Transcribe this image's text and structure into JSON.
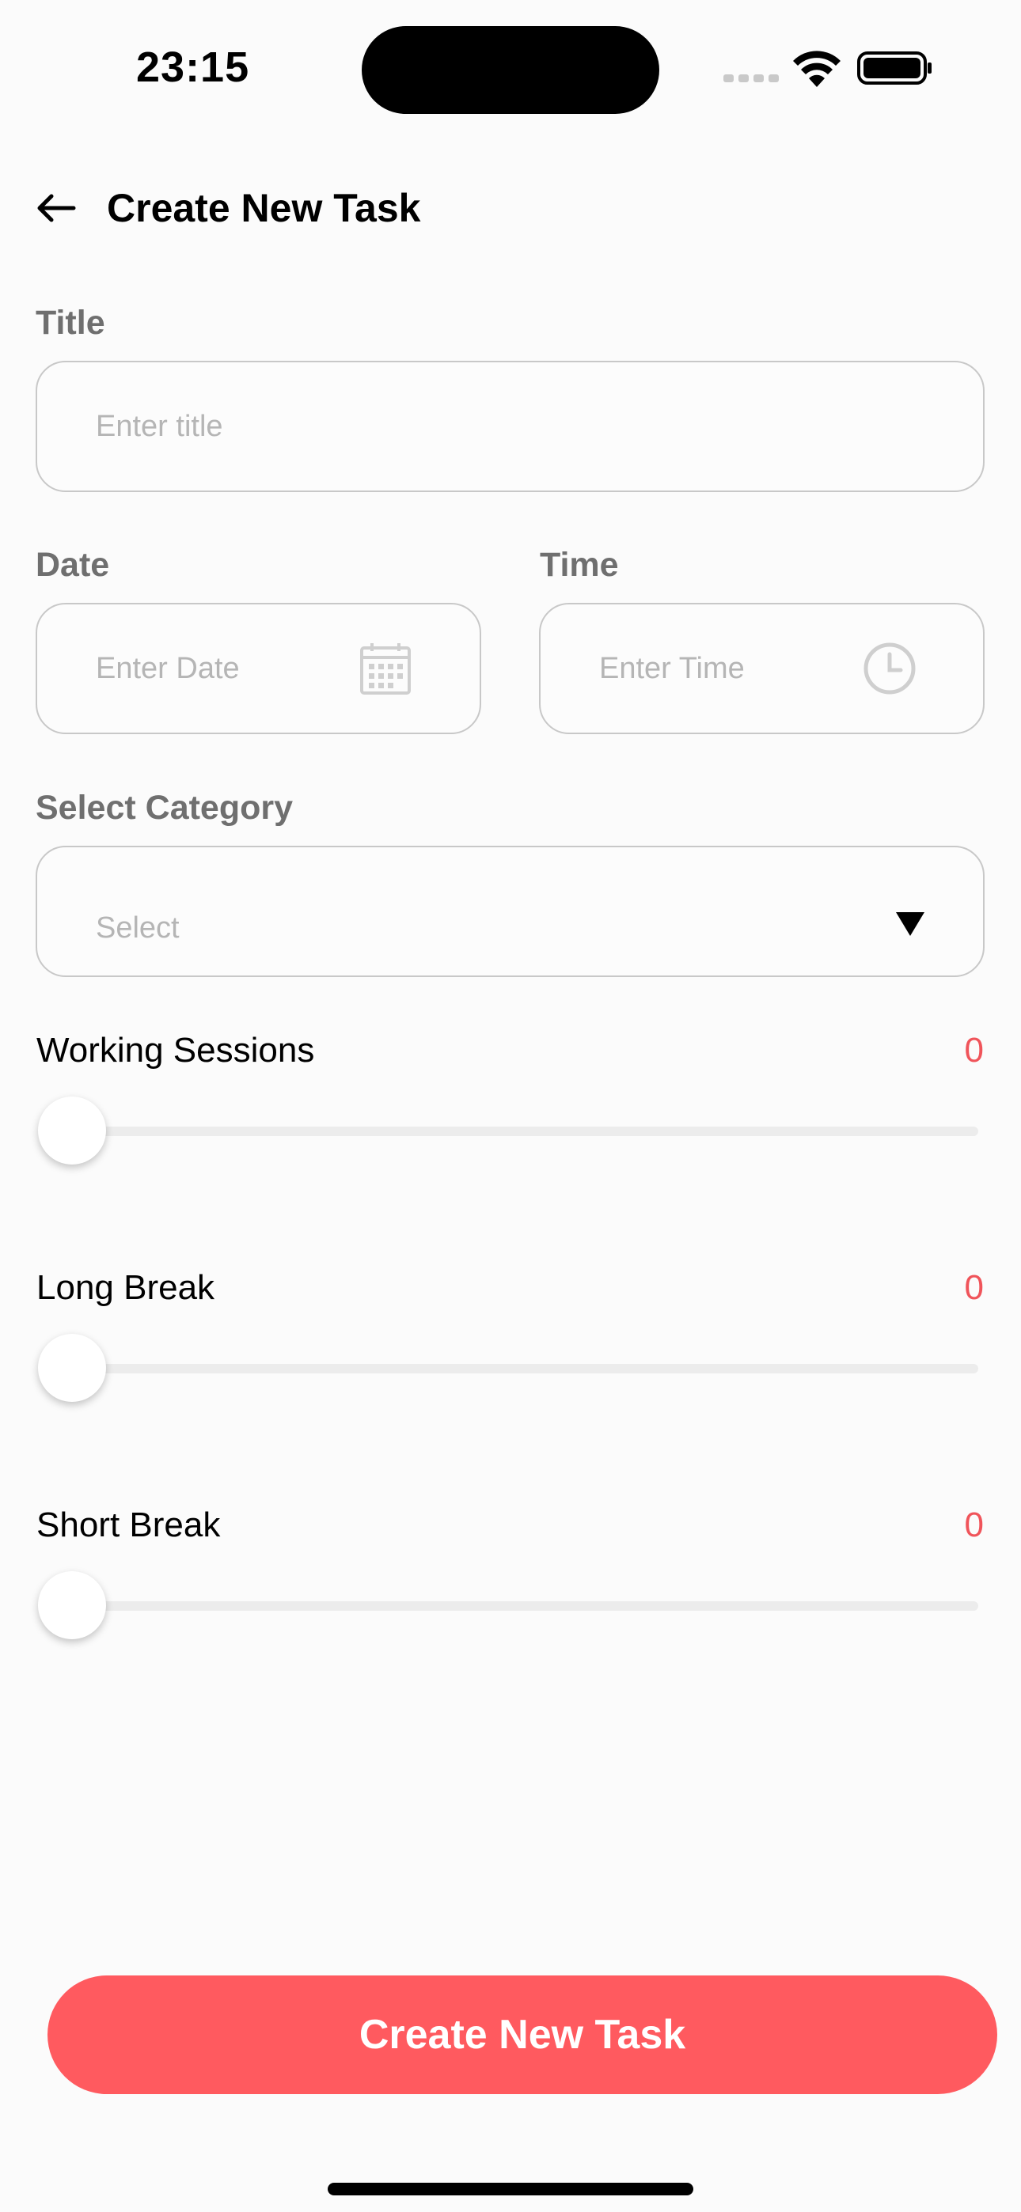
{
  "status_bar": {
    "time": "23:15",
    "signal_icon": "cellular-signal-icon",
    "wifi_icon": "wifi-icon",
    "battery_icon": "battery-icon"
  },
  "header": {
    "back_icon": "arrow-left-icon",
    "title": "Create New Task"
  },
  "form": {
    "title": {
      "label": "Title",
      "placeholder": "Enter title",
      "value": ""
    },
    "date": {
      "label": "Date",
      "placeholder": "Enter Date",
      "icon": "calendar-icon",
      "value": ""
    },
    "time": {
      "label": "Time",
      "placeholder": "Enter Time",
      "icon": "clock-icon",
      "value": ""
    },
    "category": {
      "label": "Select Category",
      "placeholder": "Select",
      "icon": "triangle-down-icon"
    }
  },
  "sliders": {
    "working_sessions": {
      "label": "Working Sessions",
      "value": "0",
      "fraction": 0
    },
    "long_break": {
      "label": "Long Break",
      "value": "0",
      "fraction": 0
    },
    "short_break": {
      "label": "Short Break",
      "value": "0",
      "fraction": 0
    }
  },
  "submit": {
    "label": "Create New Task"
  },
  "colors": {
    "accent": "#ff5a5f",
    "value_text": "#f0545a",
    "label_text": "#6f6f6f",
    "placeholder": "#b5b5b5",
    "border": "#c8c8c8",
    "background": "#fbfbfb"
  }
}
